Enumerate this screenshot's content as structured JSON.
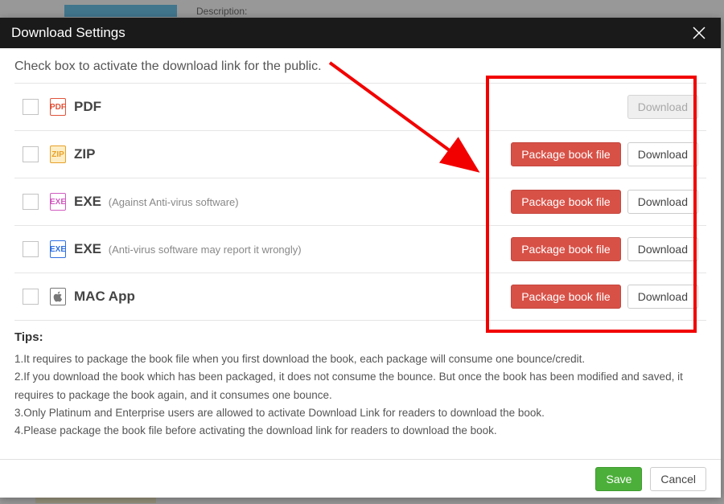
{
  "bg": {
    "description_label": "Description:"
  },
  "modal": {
    "title": "Download Settings",
    "instruction": "Check box to activate the download link for the public.",
    "package_label": "Package book file",
    "download_label": "Download",
    "options": [
      {
        "label": "PDF",
        "note": "",
        "icon": "PDF",
        "pkg": false,
        "dl": true,
        "dl_disabled": true
      },
      {
        "label": "ZIP",
        "note": "",
        "icon": "ZIP",
        "pkg": true,
        "dl": true,
        "dl_disabled": false
      },
      {
        "label": "EXE",
        "note": "(Against Anti-virus software)",
        "icon": "EXE",
        "pkg": true,
        "dl": true,
        "dl_disabled": false
      },
      {
        "label": "EXE",
        "note": "(Anti-virus software may report it wrongly)",
        "icon": "EXE",
        "pkg": true,
        "dl": true,
        "dl_disabled": false
      },
      {
        "label": "MAC App",
        "note": "",
        "icon": "MAC",
        "pkg": true,
        "dl": true,
        "dl_disabled": false
      }
    ],
    "tips_title": "Tips:",
    "tips": [
      "1.It requires to package the book file when you first download the book, each package will consume one bounce/credit.",
      "2.If you download the book which has been packaged, it does not consume the bounce. But once the book has been modified and saved, it requires to package the book again, and it consumes one bounce.",
      "3.Only Platinum and Enterprise users are allowed to activate Download Link for readers to download the book.",
      "4.Please package the book file before activating the download link for readers to download the book."
    ],
    "save_label": "Save",
    "cancel_label": "Cancel"
  },
  "colors": {
    "accent_red": "#d85147",
    "accent_green": "#4caf3a",
    "annotation_red": "#f20000"
  }
}
